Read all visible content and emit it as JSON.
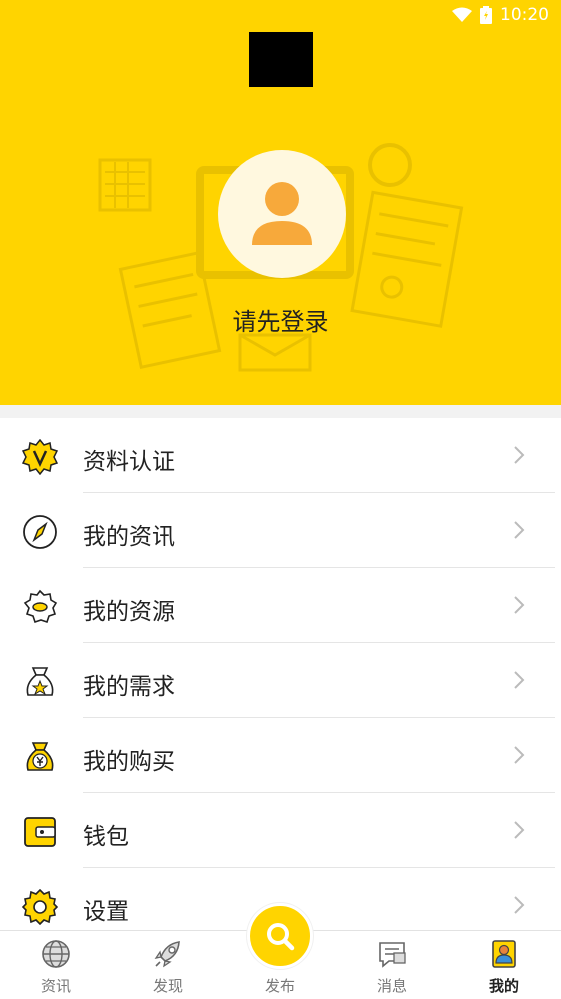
{
  "status_bar": {
    "time": "10:20"
  },
  "profile": {
    "login_prompt": "请先登录"
  },
  "menu": {
    "items": [
      {
        "label": "资料认证",
        "icon": "verify-badge-icon"
      },
      {
        "label": "我的资讯",
        "icon": "compass-icon"
      },
      {
        "label": "我的资源",
        "icon": "resource-badge-icon"
      },
      {
        "label": "我的需求",
        "icon": "star-bag-icon"
      },
      {
        "label": "我的购买",
        "icon": "yen-bag-icon"
      },
      {
        "label": "钱包",
        "icon": "wallet-icon"
      },
      {
        "label": "设置",
        "icon": "gear-icon"
      }
    ]
  },
  "bottom_nav": {
    "items": [
      {
        "label": "资讯",
        "icon": "globe-icon"
      },
      {
        "label": "发现",
        "icon": "rocket-icon"
      },
      {
        "label": "发布",
        "icon": "search-icon"
      },
      {
        "label": "消息",
        "icon": "message-icon"
      },
      {
        "label": "我的",
        "icon": "profile-icon",
        "active": true
      }
    ]
  },
  "colors": {
    "accent": "#ffd400",
    "avatar_bg": "#fff8df",
    "avatar_fg": "#f7a93b"
  }
}
